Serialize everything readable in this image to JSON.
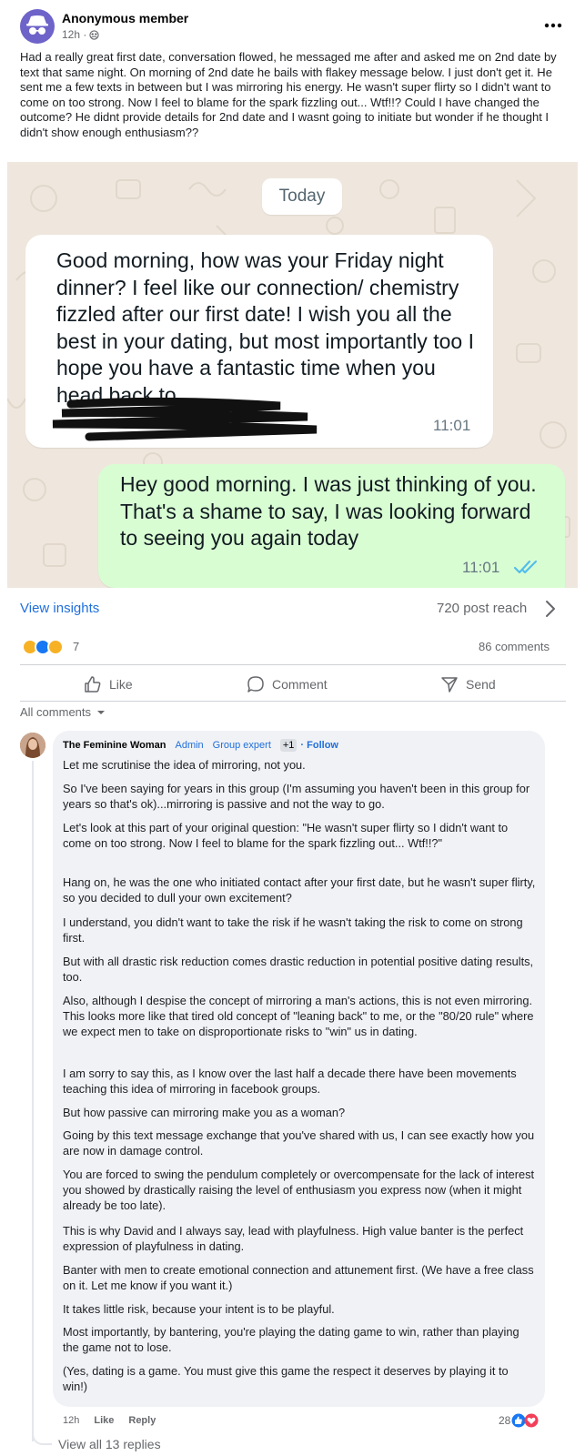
{
  "post": {
    "author": "Anonymous member",
    "time": "12h ·",
    "body": "Had a really great first date, conversation flowed, he messaged me after and asked me on 2nd date by text that same night. On morning of 2nd date he bails with flakey message below. I just don't get it. He sent me a few texts in between but I was mirroring his energy. He wasn't super flirty so I didn't want to come on too strong. Now I feel to blame for the spark fizzling out... Wtf!!? Could I have changed the outcome? He didnt provide details for 2nd date and I wasnt going to initiate but wonder if he thought I didn't show enough enthusiasm??"
  },
  "chat": {
    "date_label": "Today",
    "incoming": {
      "text": "Good morning, how was your Friday night dinner? I feel like our connection/ chemistry fizzled after our first date! I wish you all the best in your dating, but most importantly too I hope you have a fantastic time when you head back to",
      "time": "11:01"
    },
    "outgoing": {
      "text": "Hey good morning. I was just thinking of you. That's a shame to say, I was looking forward to seeing you again today",
      "time": "11:01"
    }
  },
  "stats": {
    "insights_label": "View insights",
    "reach": "720 post reach",
    "reaction_count": "7",
    "comments": "86 comments"
  },
  "actions": {
    "like": "Like",
    "comment": "Comment",
    "send": "Send"
  },
  "comments_filter": "All comments",
  "comment": {
    "author": "The Feminine Woman",
    "badge_admin": "Admin",
    "badge_expert": "Group expert",
    "badge_plus": "+1",
    "follow": "· Follow",
    "paragraphs": [
      "Let me scrutinise the idea of mirroring, not you.",
      "So I've been saying for years in this group (I'm assuming you haven't been in this group for years so that's ok)...mirroring is passive and not the way to go.",
      "Let's look at this part of your original question: \"He wasn't super flirty so I didn't want to come on too strong. Now I feel to blame for the spark fizzling out... Wtf!!?\"",
      "Hang on, he was the one who initiated contact after your first date, but he wasn't super flirty, so you decided to dull your own excitement?",
      "I understand, you didn't want to take the risk if he wasn't taking the risk to come on strong first.",
      "But with all drastic risk reduction comes drastic reduction in potential positive dating results, too.",
      "Also, although I despise the concept of mirroring a man's actions, this is not even mirroring. This looks more like that tired old concept of \"leaning back\" to me, or the \"80/20 rule\" where we expect men to take on disproportionate risks to \"win\" us in dating.",
      "I am sorry to say this, as I know over the last half a decade there have been movements teaching this idea of mirroring in facebook groups.",
      "But how passive can mirroring make you as a woman?",
      "Going by this text message exchange that you've shared with us, I can see exactly how you are now in damage control.",
      "You are forced to swing the pendulum completely or overcompensate for the lack of interest you showed by drastically raising the level of enthusiasm you express now (when it might already be too late).",
      "This is why David and I always say, lead with playfulness. High value banter is the perfect expression of playfulness in dating.",
      "Banter with men to create emotional connection and attunement first. (We have a free class on it. Let me know if you want it.)",
      "It takes little risk, because your intent is to be playful.",
      "Most importantly, by bantering, you're playing the dating game to win, rather than playing the game not to lose.",
      "(Yes, dating is a game. You must give this game the respect it deserves by playing it to win!)"
    ],
    "time": "12h",
    "like": "Like",
    "reply": "Reply",
    "likes": "28",
    "view_replies": "View all 13 replies"
  },
  "colors": {
    "link_blue": "#216fdb",
    "chat_bg": "#efe7dd",
    "outgoing_bubble": "#d9fdd3",
    "comment_bubble": "#f0f2f5"
  }
}
